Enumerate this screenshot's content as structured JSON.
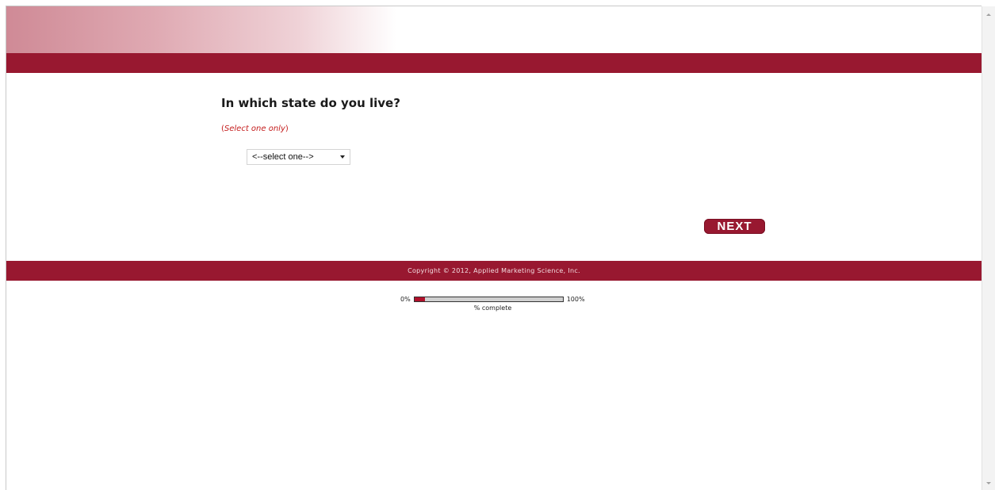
{
  "question": {
    "text": "In which state do you live?",
    "instruction_open": "(",
    "instruction_text": "Select one only",
    "instruction_close": ")"
  },
  "state_select": {
    "selected": "<--select one-->"
  },
  "next_button": {
    "label": "NEXT"
  },
  "footer": {
    "copyright": "Copyright © 2012, Applied Marketing Science, Inc."
  },
  "progress": {
    "min_label": "0%",
    "max_label": "100%",
    "caption": "% complete",
    "percent": 7
  },
  "colors": {
    "brand": "#981830",
    "instruction": "#c41c1c",
    "progress_fill": "#b0102a"
  },
  "icons": {
    "select_arrow": "chevron-down-icon",
    "scroll_up": "scroll-up-arrow-icon",
    "scroll_down": "scroll-down-arrow-icon"
  }
}
